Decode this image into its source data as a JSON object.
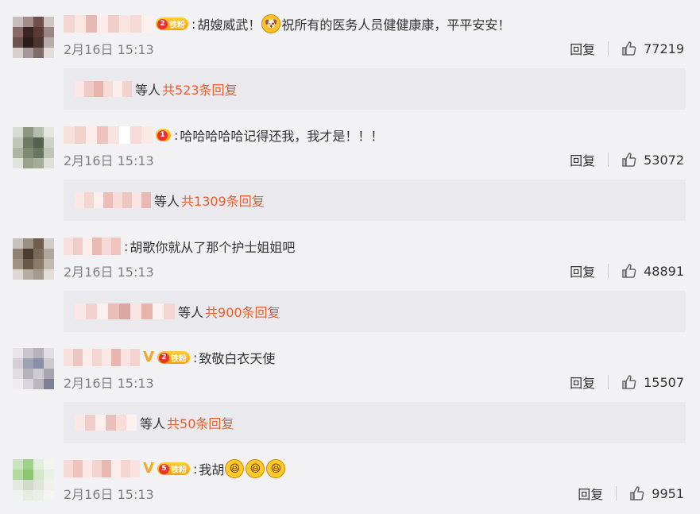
{
  "comments": [
    {
      "text": "胡嫂威武！",
      "emoji_icon": "doge-icon",
      "text2": "祝所有的医务人员健健康康，平平安安！",
      "date": "2月16日 15:13",
      "reply_label": "回复",
      "likes": "77219",
      "fan_level": "2",
      "fan_label": "铁粉",
      "sub_suffix": "等人",
      "sub_count": "共523条回复"
    },
    {
      "text": "哈哈哈哈哈记得还我，我才是！！！",
      "date": "2月16日 15:13",
      "reply_label": "回复",
      "likes": "53072",
      "fan_level": "1",
      "sub_suffix": "等人",
      "sub_count": "共1309条回复"
    },
    {
      "text": "胡歌你就从了那个护士姐姐吧",
      "date": "2月16日 15:13",
      "reply_label": "回复",
      "likes": "48891",
      "sub_suffix": "等人",
      "sub_count": "共900条回复"
    },
    {
      "text": "致敬白衣天使",
      "date": "2月16日 15:13",
      "reply_label": "回复",
      "likes": "15507",
      "fan_level": "2",
      "fan_label": "铁粉",
      "verified": "V",
      "sub_suffix": "等人",
      "sub_count": "共50条回复"
    },
    {
      "text": "我胡",
      "emoji_icon": "laughing-face-icon",
      "date": "2月16日 15:13",
      "reply_label": "回复",
      "likes": "9951",
      "fan_level": "5",
      "fan_label": "铁粉",
      "verified": "V"
    }
  ],
  "colors": {
    "background": "#f2f2f5",
    "sub_box": "#e9e9ee",
    "count_accent": "#e8602c",
    "meta_gray": "#808080",
    "badge_gold": "#f5a623"
  }
}
